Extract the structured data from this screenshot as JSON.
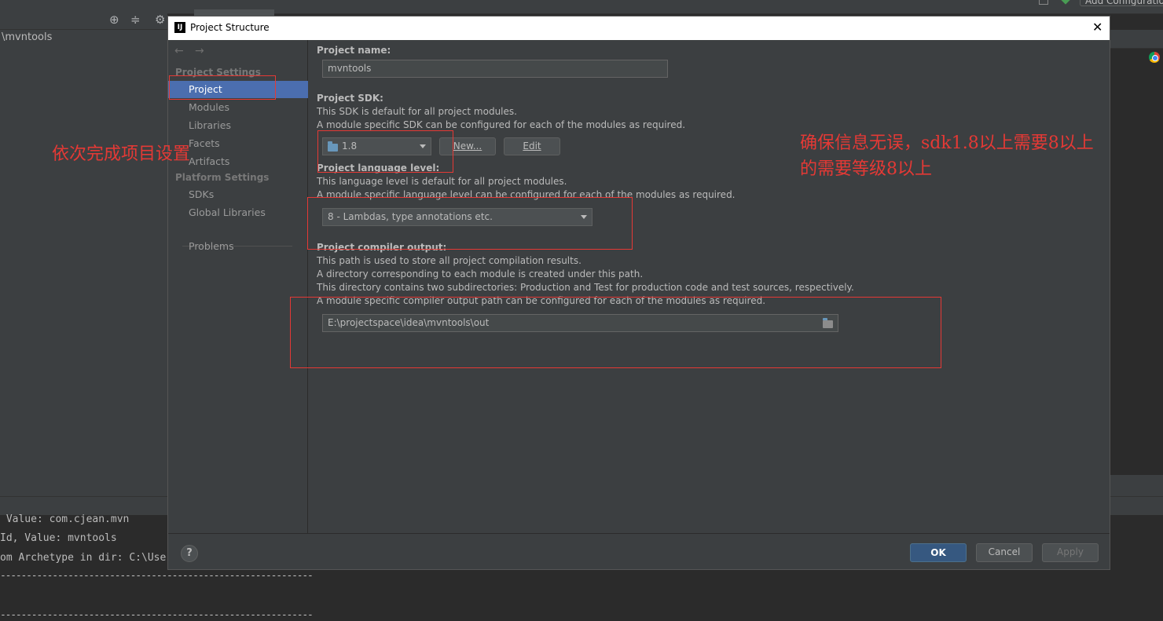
{
  "ide": {
    "project_path": "\\mvntools",
    "add_configuration": "Add Configuration...",
    "console_lines": [
      " Value: com.cjean.mvn",
      "Id, Value: mvntools",
      "om Archetype in dir: C:\\User",
      "------------------------------------------------------------",
      "------------------------------------------------------------"
    ]
  },
  "dialog": {
    "title": "Project Structure",
    "app_icon": "IJ",
    "sidebar": {
      "project_settings_header": "Project Settings",
      "project_settings_items": [
        "Project",
        "Modules",
        "Libraries",
        "Facets",
        "Artifacts"
      ],
      "platform_settings_header": "Platform Settings",
      "platform_settings_items": [
        "SDKs",
        "Global Libraries"
      ],
      "problems": "Problems",
      "selected": "Project"
    },
    "content": {
      "project_name_label": "Project name:",
      "project_name_value": "mvntools",
      "sdk_label": "Project SDK:",
      "sdk_desc1": "This SDK is default for all project modules.",
      "sdk_desc2": "A module specific SDK can be configured for each of the modules as required.",
      "sdk_value": "1.8",
      "new_button": "New...",
      "edit_button": "Edit",
      "lang_label": "Project language level:",
      "lang_desc1": "This language level is default for all project modules.",
      "lang_desc2": "A module specific language level can be configured for each of the modules as required.",
      "lang_value": "8 - Lambdas, type annotations etc.",
      "output_label": "Project compiler output:",
      "output_desc1": "This path is used to store all project compilation results.",
      "output_desc2": "A directory corresponding to each module is created under this path.",
      "output_desc3": "This directory contains two subdirectories: Production and Test for production code and test sources, respectively.",
      "output_desc4": "A module specific compiler output path can be configured for each of the modules as required.",
      "output_value": "E:\\projectspace\\idea\\mvntools\\out"
    },
    "footer": {
      "help": "?",
      "ok": "OK",
      "cancel": "Cancel",
      "apply": "Apply"
    }
  },
  "annotations": {
    "left_note": "依次完成项目设置",
    "right_note_line1": "确保信息无误，sdk1.8以上需要8以上",
    "right_note_line2": "的需要等级8以上",
    "color": "#e53935"
  },
  "icons": {
    "close": "close-icon",
    "back": "back-arrow-icon",
    "forward": "forward-arrow-icon",
    "folder": "folder-icon",
    "dropdown": "chevron-down-icon",
    "browser": "chrome-icon"
  }
}
